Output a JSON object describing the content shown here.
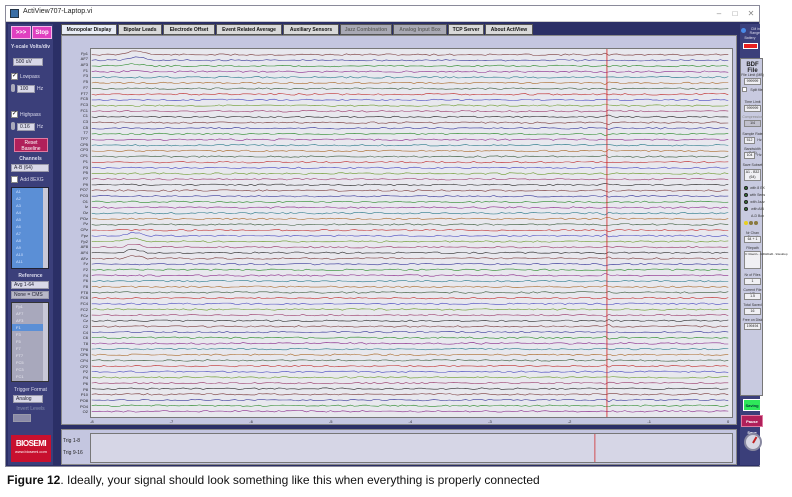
{
  "window": {
    "title": "ActiView707-Laptop.vi",
    "min": "–",
    "max": "□",
    "close": "✕"
  },
  "left": {
    "arrow_btn": ">>>",
    "stop_btn": "Stop",
    "yscale_label": "Y-scale Volts/div",
    "yscale_value": "500 uV",
    "lowpass_label": "Lowpass",
    "lowpass_value": "100",
    "lowpass_unit": "Hz",
    "highpass_label": "Highpass",
    "highpass_value": "0.16",
    "highpass_unit": "Hz",
    "reset_btn": "Reset Baseline",
    "channels_label": "Channels",
    "channels_value": "A-B (64)",
    "add_label": "Add 8EXG",
    "channel_list": [
      "A1",
      "A2",
      "A3",
      "A4",
      "A5",
      "A6",
      "A7",
      "A8",
      "A9",
      "A10",
      "A11"
    ],
    "reference_label": "Reference",
    "reference_value": "Avg 1-64",
    "none_label": "None = CMS",
    "ref_list": [
      "Fp1",
      "AF7",
      "AF3",
      "F1",
      "F3",
      "F5",
      "F7",
      "FT7",
      "FC5",
      "FC3",
      "FC1"
    ],
    "trigger_label": "Trigger Format",
    "trigger_value": "Analog",
    "invert_label": "Invert Levels",
    "brand_top": "BIOSEMI",
    "brand_url": "www.biosemi.com"
  },
  "tabs": [
    {
      "label": "Monopolar Display",
      "active": true
    },
    {
      "label": "Bipolar Leads"
    },
    {
      "label": "Electrode Offset"
    },
    {
      "label": "Event Related Average"
    },
    {
      "label": "Auxiliary Sensors"
    },
    {
      "label": "Jazz Combination",
      "dim": true
    },
    {
      "label": "Analog Input Box",
      "dim": true
    },
    {
      "label": "TCP Server"
    },
    {
      "label": "About ActiView"
    }
  ],
  "plot": {
    "channels": [
      "Fp1",
      "AF7",
      "AF3",
      "F1",
      "F3",
      "F5",
      "F7",
      "FT7",
      "FC5",
      "FC3",
      "FC1",
      "C1",
      "C3",
      "C5",
      "T7",
      "TP7",
      "CP5",
      "CP3",
      "CP1",
      "P1",
      "P3",
      "P5",
      "P7",
      "P9",
      "PO7",
      "PO3",
      "O1",
      "Iz",
      "Oz",
      "POz",
      "Pz",
      "CPz",
      "Fpz",
      "Fp2",
      "AF8",
      "AF4",
      "AFz",
      "Fz",
      "F2",
      "F4",
      "F6",
      "F8",
      "FT8",
      "FC6",
      "FC4",
      "FC2",
      "FCz",
      "Cz",
      "C2",
      "C4",
      "C6",
      "T8",
      "TP8",
      "CP6",
      "CP4",
      "CP2",
      "P2",
      "P4",
      "P6",
      "P8",
      "P10",
      "PO8",
      "PO4",
      "O2"
    ],
    "ticks": [
      "-8",
      "-7",
      "-6",
      "-5",
      "-4",
      "-3",
      "-2",
      "-1",
      "0"
    ],
    "trig1": "Trig 1-8",
    "trig2": "Trig 9-16",
    "colors": [
      "#7a3a3a",
      "#3a3a9a",
      "#2a8a2a",
      "#8a2a8a",
      "#2a7a8a",
      "#aa6a2a",
      "#3a5a3a",
      "#c03030",
      "#4a4ac0",
      "#6a9a2a",
      "#9a3a6a",
      "#2a2a2a"
    ],
    "cursor_color": "#d02020"
  },
  "right": {
    "cm_label": "CM in Range",
    "battery_label": "Battery",
    "bdf_title": "BDF File",
    "file_limit_label": "File Limit (MB)",
    "file_limit_value": "999999",
    "time_limit_label": "Time Limit (sec)",
    "time_limit_value": "999999",
    "split_label": "Split file",
    "compression_label": "Compression",
    "compression_value": "1/4",
    "sample_rate_label": "Sample Rate",
    "sample_rate_value": "512",
    "sample_rate_unit": "Hz",
    "bandwidth_label": "Bandwidth (3dB)",
    "bandwidth_value": "104",
    "bandwidth_unit": "Hz",
    "subset_label": "Save Subset",
    "subset_value": "A1 - B32 (64)",
    "opt1": "with 8 EX",
    "opt2": "with Sens",
    "opt3": "with Jazz",
    "opt4": "with AIB",
    "aux_label": "A-D Box",
    "nr_saved_label": "Nr Chan Saved",
    "nr_saved_value": "64 + 1",
    "filepath_label": "Filepath",
    "filepath_value": "C:\\Users\\...\\ADHDaD...\\Desktop",
    "nr_files_label": "Nr of Files",
    "nr_files_value": "1",
    "current_file_label": "Current File MB",
    "current_file_value": "1.5",
    "total_saved_label": "Total Saved sec",
    "total_saved_value": "16",
    "free_disk_label": "Free on Disk sec",
    "free_disk_value": "199494",
    "saving_btn": "Saving",
    "pause_btn": "Pause Save"
  },
  "caption": {
    "prefix": "Figure 12",
    "text": ". Ideally, your signal should look something like this when everything is properly connected"
  }
}
